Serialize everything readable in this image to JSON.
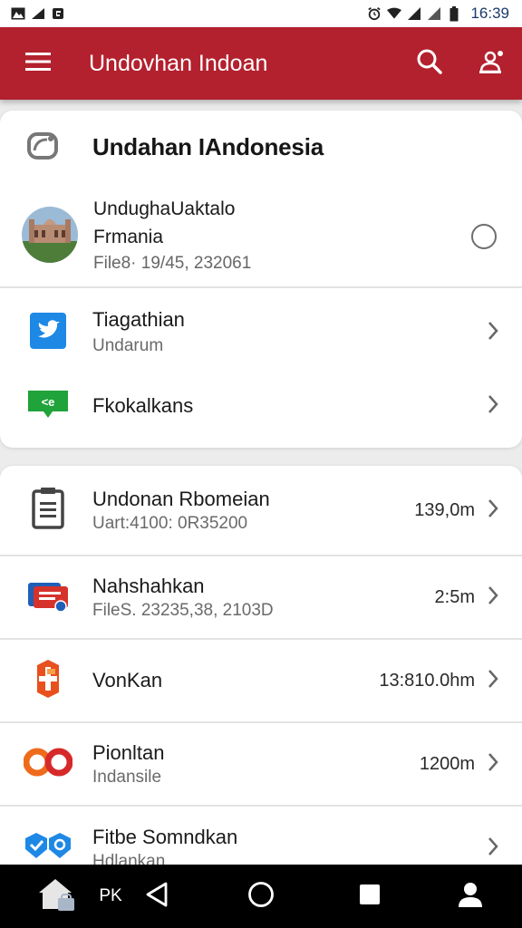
{
  "status_bar": {
    "left_icons": [
      "gallery-icon",
      "signal-icon",
      "notification-icon"
    ],
    "right_icons": [
      "alarm-icon",
      "wifi-icon",
      "cell-signal-icon",
      "cell-signal-2-icon",
      "battery-icon"
    ],
    "time": "16:39"
  },
  "app_bar": {
    "title": "Undovhan Indoan",
    "background": "#b3202e",
    "icons": [
      "menu-icon",
      "search-icon",
      "account-settings-icon"
    ]
  },
  "section": {
    "title": "Undahan IAndonesia",
    "icon": "camera-icon"
  },
  "profile": {
    "name_line1": "UndughaUaktalo",
    "name_line2": "Frmania",
    "meta": "File8· 19/45, 232061",
    "icon": "palace-photo"
  },
  "nav_items": [
    {
      "label": "Tiagathian",
      "sub": "Undarum",
      "icon": "twitter-bird-icon"
    },
    {
      "label": "Fkokalkans",
      "sub": "",
      "icon": "chat-bubble-icon"
    }
  ],
  "list_items": [
    {
      "title": "Undonan Rbomeian",
      "sub": "Uart:4100: 0R35200",
      "value": "139,0m",
      "icon": "document-icon"
    },
    {
      "title": "Nahshahkan",
      "sub": "FileS. 23235,38, 2103D",
      "value": "2:5m",
      "icon": "mail-card-icon"
    },
    {
      "title": "VonKan",
      "sub": "",
      "value": "13:810.0hm",
      "icon": "orange-badge-icon"
    },
    {
      "title": "Pionltan",
      "sub": "Indansile",
      "value": "1200m",
      "icon": "infinity-icon"
    },
    {
      "title": "Fitbe Somndkan",
      "sub": "Hdlankan",
      "value": "",
      "icon": "shield-pair-icon"
    }
  ],
  "nav_bar": {
    "text": "PK",
    "icons": [
      "home-icon",
      "back-icon",
      "home-circle-icon",
      "recents-icon",
      "person-icon"
    ]
  }
}
